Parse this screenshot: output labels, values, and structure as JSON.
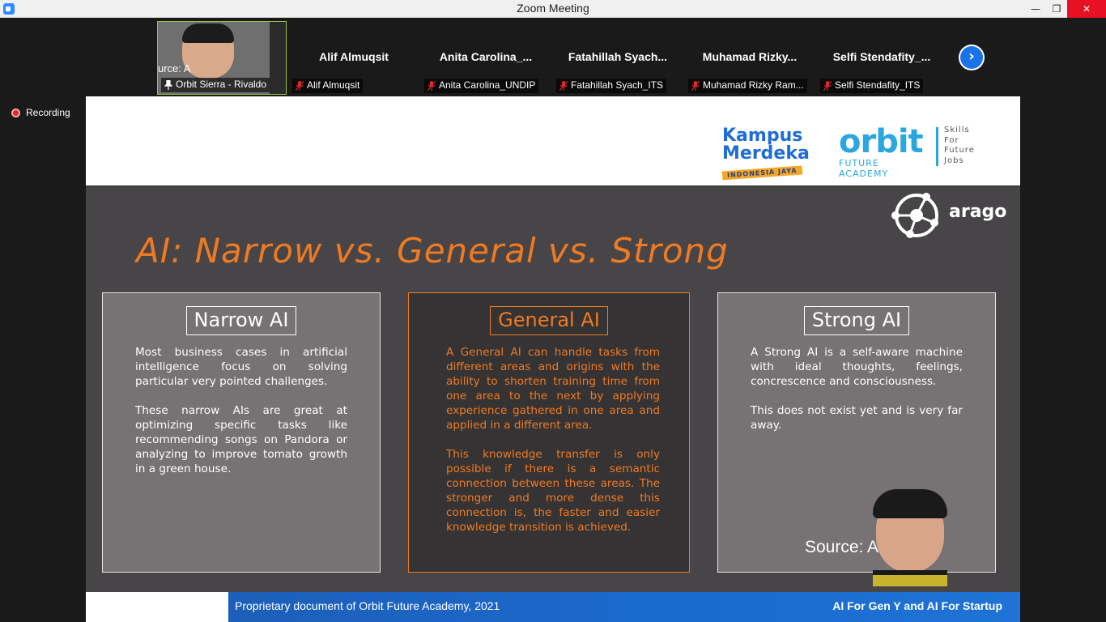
{
  "window": {
    "title": "Zoom Meeting",
    "minimize": "—",
    "maximize": "❐",
    "close": "✕"
  },
  "participants": {
    "active": {
      "label": "Orbit Sierra - Rivaldo",
      "overlay_text": "urce: A"
    },
    "tiles": [
      {
        "display_name": "Alif Almuqsit",
        "label": "Alif Almuqsit"
      },
      {
        "display_name": "Anita  Carolina_...",
        "label": "Anita Carolina_UNDIP"
      },
      {
        "display_name": "Fatahillah  Syach...",
        "label": "Fatahillah Syach_ITS"
      },
      {
        "display_name": "Muhamad  Rizky...",
        "label": "Muhamad Rizky Ram..."
      },
      {
        "display_name": "Selfi  Stendafity_...",
        "label": "Selfi Stendafity_ITS"
      }
    ],
    "next_icon": "›"
  },
  "recording": {
    "label": "Recording"
  },
  "slide": {
    "logos": {
      "kampus_line1": "Kampus",
      "kampus_line2": "Merdeka",
      "kampus_sub": "INDONESIA JAYA",
      "orbit": "orbit",
      "orbit_sub": "FUTURE ACADEMY",
      "tagline": [
        "Skills",
        "For",
        "Future",
        "Jobs"
      ],
      "arago": "arago"
    },
    "title": "AI: Narrow vs. General vs. Strong",
    "boxes": {
      "narrow": {
        "heading": "Narrow AI",
        "p1": "Most business cases in artificial intelligence focus on solving particular very pointed challenges.",
        "p2": "These narrow AIs are great at optimizing specific tasks like recommending songs on Pandora or analyzing to improve tomato growth in a green house."
      },
      "general": {
        "heading": "General AI",
        "p1": "A General AI can handle tasks from different areas and origins with the ability to shorten training time from one area to the next by applying experience gathered in one area and applied in a different area.",
        "p2": "This knowledge transfer is only possible if there is a semantic connection between these areas. The stronger and more dense this connection is, the faster and easier knowledge transition is achieved."
      },
      "strong": {
        "heading": "Strong AI",
        "p1": "A Strong AI is a self-aware machine with ideal thoughts, feelings, concrescence and consciousness.",
        "p2": "This does not exist yet and is very far away."
      }
    },
    "presenter_overlay": "Source: A",
    "footer_left": "Proprietary document of Orbit Future Academy, 2021",
    "footer_right": "AI For Gen Y and AI For Startup"
  },
  "colors": {
    "accent_orange": "#f07a22",
    "zoom_blue": "#2d8cff",
    "footer_blue": "#1a6bd0",
    "recording_red": "#e02828"
  }
}
